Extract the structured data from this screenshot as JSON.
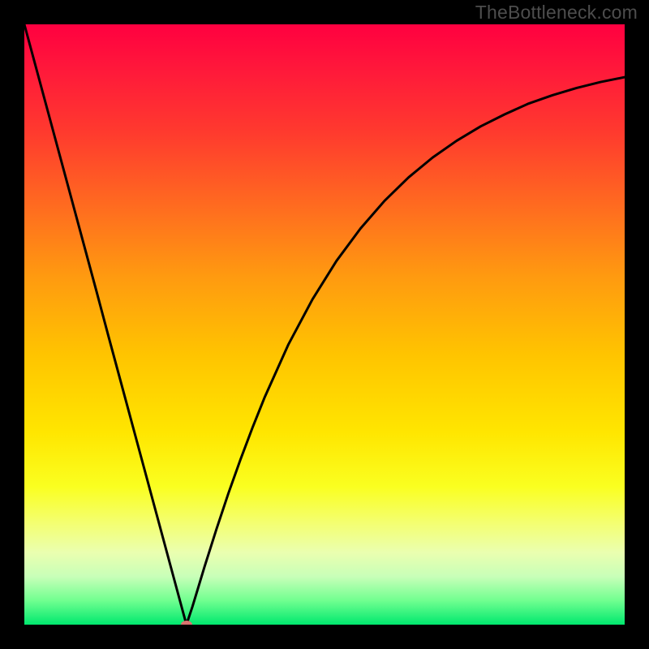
{
  "watermark": "TheBottleneck.com",
  "colors": {
    "frame": "#000000",
    "curve": "#000000",
    "marker": "#d9736f"
  },
  "chart_data": {
    "type": "line",
    "title": "",
    "xlabel": "",
    "ylabel": "",
    "xlim": [
      0,
      100
    ],
    "ylim": [
      0,
      100
    ],
    "x": [
      0,
      2,
      4,
      6,
      8,
      10,
      12,
      14,
      16,
      18,
      20,
      22,
      24,
      25,
      26,
      27,
      28,
      29,
      30,
      32,
      34,
      36,
      38,
      40,
      44,
      48,
      52,
      56,
      60,
      64,
      68,
      72,
      76,
      80,
      84,
      88,
      92,
      96,
      100
    ],
    "values": [
      100,
      92.6,
      85.2,
      77.8,
      70.4,
      63.0,
      55.6,
      48.1,
      40.7,
      33.3,
      25.9,
      18.5,
      11.1,
      7.4,
      3.7,
      0.0,
      3.0,
      6.3,
      9.6,
      15.9,
      21.9,
      27.5,
      32.8,
      37.8,
      46.7,
      54.2,
      60.6,
      66.0,
      70.6,
      74.5,
      77.8,
      80.6,
      83.0,
      85.0,
      86.8,
      88.2,
      89.4,
      90.4,
      91.2
    ],
    "marker": {
      "x": 27,
      "y": 0
    },
    "grid": false,
    "legend": false,
    "background_gradient": {
      "top": "#ff0040",
      "mid": "#ffe600",
      "bottom": "#00e86e"
    }
  }
}
